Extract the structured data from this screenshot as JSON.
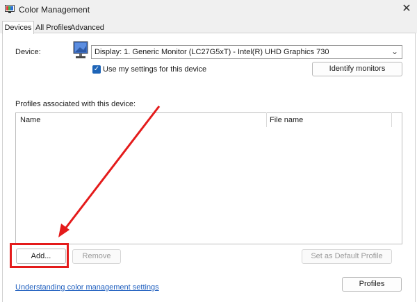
{
  "window": {
    "title": "Color Management",
    "close_glyph": "✕",
    "icon": "color-management-icon"
  },
  "tabs": [
    {
      "label": "Devices",
      "selected": true
    },
    {
      "label": "All Profiles",
      "selected": false
    },
    {
      "label": "Advanced",
      "selected": false
    }
  ],
  "device": {
    "label": "Device:",
    "selected": "Display: 1. Generic Monitor (LC27G5xT) - Intel(R) UHD Graphics 730",
    "use_my_settings_label": "Use my settings for this device",
    "use_my_settings_checked": true,
    "identify_label": "Identify monitors"
  },
  "profiles": {
    "section_label": "Profiles associated with this device:",
    "columns": [
      "Name",
      "File name"
    ],
    "rows": []
  },
  "buttons": {
    "add": "Add...",
    "remove": "Remove",
    "set_default": "Set as Default Profile",
    "profiles": "Profiles"
  },
  "footer": {
    "help_link": "Understanding color management settings"
  },
  "annotation": {
    "color": "#e41b1b"
  }
}
